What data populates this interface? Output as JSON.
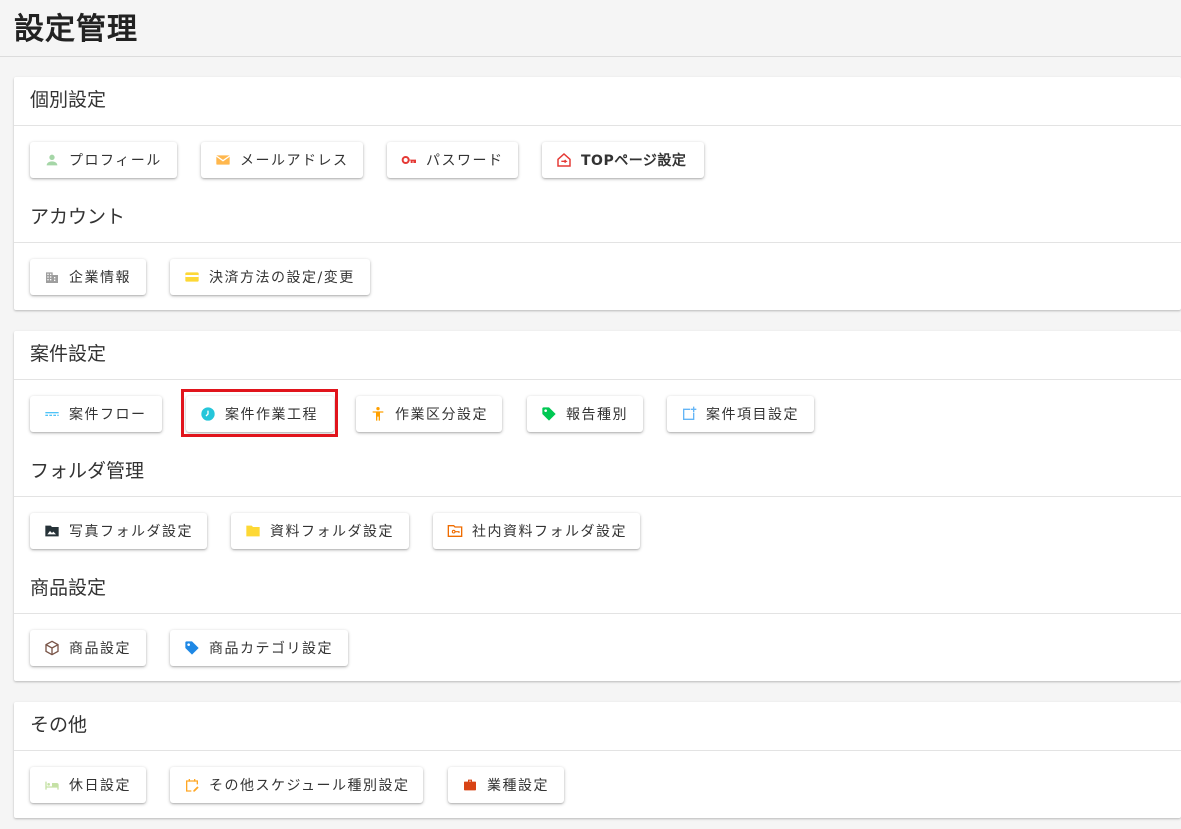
{
  "page": {
    "title": "設定管理"
  },
  "cards": [
    {
      "sections": [
        {
          "title": "個別設定",
          "buttons": [
            {
              "label": "プロフィール",
              "icon": "person-icon",
              "color": "#a5d6a7"
            },
            {
              "label": "メールアドレス",
              "icon": "email-icon",
              "color": "#ffb74d"
            },
            {
              "label": "パスワード",
              "icon": "key-icon",
              "color": "#e53935"
            },
            {
              "label": "TOPページ設定",
              "icon": "home-icon",
              "color": "#e53935"
            }
          ]
        },
        {
          "title": "アカウント",
          "buttons": [
            {
              "label": "企業情報",
              "icon": "building-icon",
              "color": "#9e9e9e"
            },
            {
              "label": "決済方法の設定/変更",
              "icon": "credit-card-icon",
              "color": "#fdd835"
            }
          ]
        }
      ]
    },
    {
      "sections": [
        {
          "title": "案件設定",
          "buttons": [
            {
              "label": "案件フロー",
              "icon": "flow-icon",
              "color": "#4fc3f7"
            },
            {
              "label": "案件作業工程",
              "icon": "clock-icon",
              "color": "#26c6da"
            },
            {
              "label": "作業区分設定",
              "icon": "figure-icon",
              "color": "#ffa000"
            },
            {
              "label": "報告種別",
              "icon": "tag-icon",
              "color": "#00c853"
            },
            {
              "label": "案件項目設定",
              "icon": "add-box-icon",
              "color": "#64b5f6"
            }
          ]
        },
        {
          "title": "フォルダ管理",
          "buttons": [
            {
              "label": "写真フォルダ設定",
              "icon": "photo-icon",
              "color": "#263238"
            },
            {
              "label": "資料フォルダ設定",
              "icon": "folder-icon",
              "color": "#fdd835"
            },
            {
              "label": "社内資料フォルダ設定",
              "icon": "shared-folder-icon",
              "color": "#ef6c00"
            }
          ]
        },
        {
          "title": "商品設定",
          "buttons": [
            {
              "label": "商品設定",
              "icon": "box-icon",
              "color": "#795548"
            },
            {
              "label": "商品カテゴリ設定",
              "icon": "category-tag-icon",
              "color": "#1e88e5"
            }
          ]
        }
      ]
    },
    {
      "sections": [
        {
          "title": "その他",
          "buttons": [
            {
              "label": "休日設定",
              "icon": "bed-icon",
              "color": "#c5e1a5"
            },
            {
              "label": "その他スケジュール種別設定",
              "icon": "calendar-edit-icon",
              "color": "#ffa726"
            },
            {
              "label": "業種設定",
              "icon": "briefcase-icon",
              "color": "#d84315"
            }
          ]
        }
      ]
    }
  ]
}
